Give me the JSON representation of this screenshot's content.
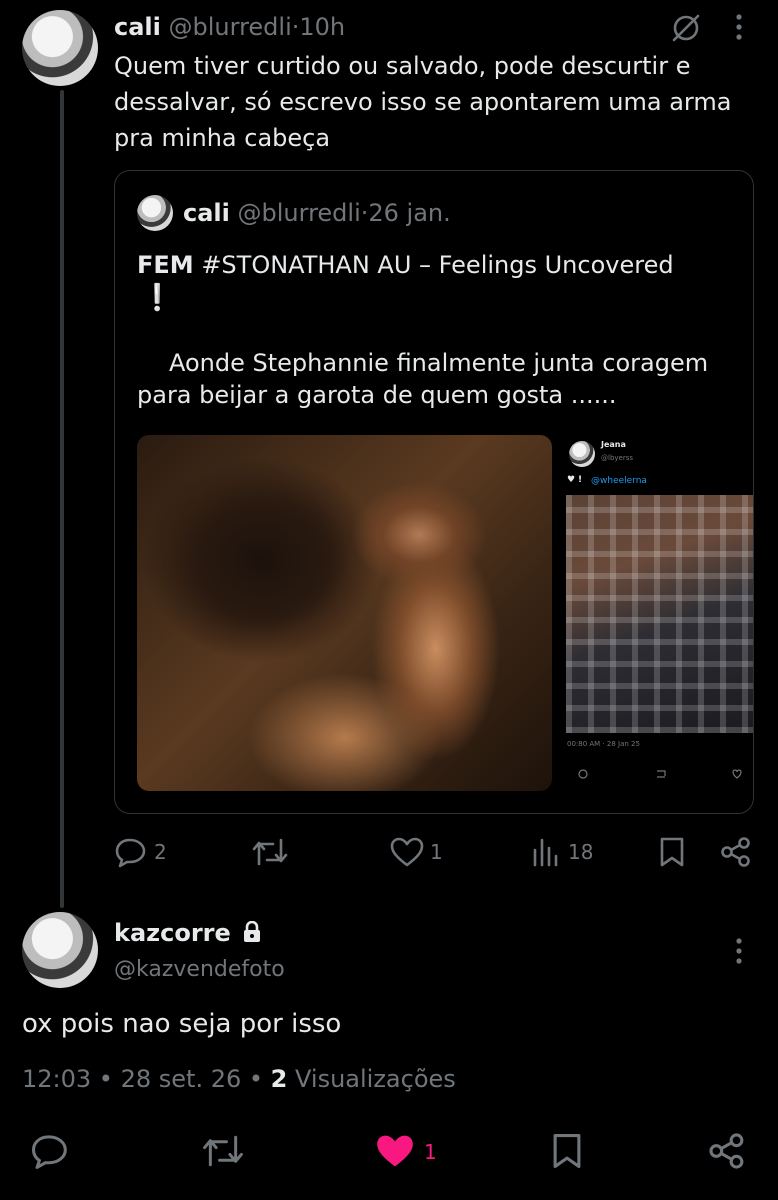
{
  "main_tweet": {
    "display_name": "cali",
    "handle": "@blurredli",
    "separator": "·",
    "time": "10h",
    "text": "Quem tiver curtido ou salvado, pode descurtir e dessalvar, só escrevo isso se apontarem uma arma pra minha cabeça",
    "quote": {
      "display_name": "cali",
      "handle": "@blurredli",
      "separator": "·",
      "date": "26 jan.",
      "title_bold": "FEM",
      "title_rest": "#STONATHAN AU  –  Feelings Uncovered",
      "exclaim": "❕",
      "body": "Aonde Stephannie finalmente junta coragem para beijar a garota de quem gosta ......",
      "embedded": {
        "name": "Jeana",
        "handle": "@lbyerss",
        "reply_text": "@wheelerna",
        "timestamp": "00:80 AM · 28 Jan 25"
      }
    },
    "actions": {
      "replies": "2",
      "retweets": "",
      "likes": "1",
      "views": "18"
    }
  },
  "reply_tweet": {
    "display_name": "kazcorre",
    "handle": "@kazvendefoto",
    "text": "ox pois nao seja por isso",
    "time": "12:03",
    "date": "28 set. 26",
    "views_count": "2",
    "views_label": "Visualizações",
    "like_count": "1",
    "like_color": "#f91880"
  }
}
